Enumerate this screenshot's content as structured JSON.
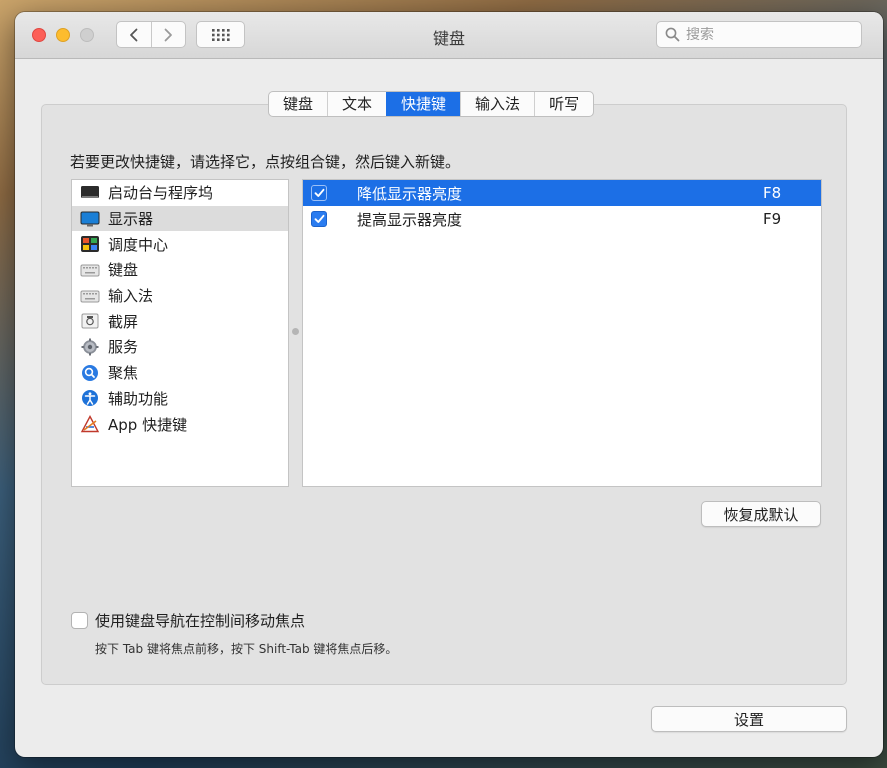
{
  "window": {
    "title": "键盘",
    "search_placeholder": "搜索"
  },
  "tabs": [
    {
      "label": "键盘",
      "active": false
    },
    {
      "label": "文本",
      "active": false
    },
    {
      "label": "快捷键",
      "active": true
    },
    {
      "label": "输入法",
      "active": false
    },
    {
      "label": "听写",
      "active": false
    }
  ],
  "instruction": "若要更改快捷键，请选择它，点按组合键，然后键入新键。",
  "categories": [
    {
      "label": "启动台与程序坞",
      "icon": "launchpad-icon",
      "selected": false
    },
    {
      "label": "显示器",
      "icon": "display-icon",
      "selected": true
    },
    {
      "label": "调度中心",
      "icon": "mission-control-icon",
      "selected": false
    },
    {
      "label": "键盘",
      "icon": "keyboard-icon",
      "selected": false
    },
    {
      "label": "输入法",
      "icon": "input-source-icon",
      "selected": false
    },
    {
      "label": "截屏",
      "icon": "screenshot-icon",
      "selected": false
    },
    {
      "label": "服务",
      "icon": "gear-icon",
      "selected": false
    },
    {
      "label": "聚焦",
      "icon": "spotlight-icon",
      "selected": false
    },
    {
      "label": "辅助功能",
      "icon": "accessibility-icon",
      "selected": false
    },
    {
      "label": "App 快捷键",
      "icon": "app-shortcuts-icon",
      "selected": false
    }
  ],
  "shortcuts": [
    {
      "name": "降低显示器亮度",
      "key": "F8",
      "checked": true,
      "selected": true
    },
    {
      "name": "提高显示器亮度",
      "key": "F9",
      "checked": true,
      "selected": false
    }
  ],
  "buttons": {
    "restore_defaults": "恢复成默认",
    "setup_partial": "设置"
  },
  "keyboard_navigation": {
    "label": "使用键盘导航在控制间移动焦点",
    "hint": "按下 Tab 键将焦点前移，按下 Shift-Tab 键将焦点后移。",
    "checked": false
  },
  "colors": {
    "accent": "#1c6fe6",
    "close": "#fc5f57",
    "minimize": "#fdbc2e"
  }
}
